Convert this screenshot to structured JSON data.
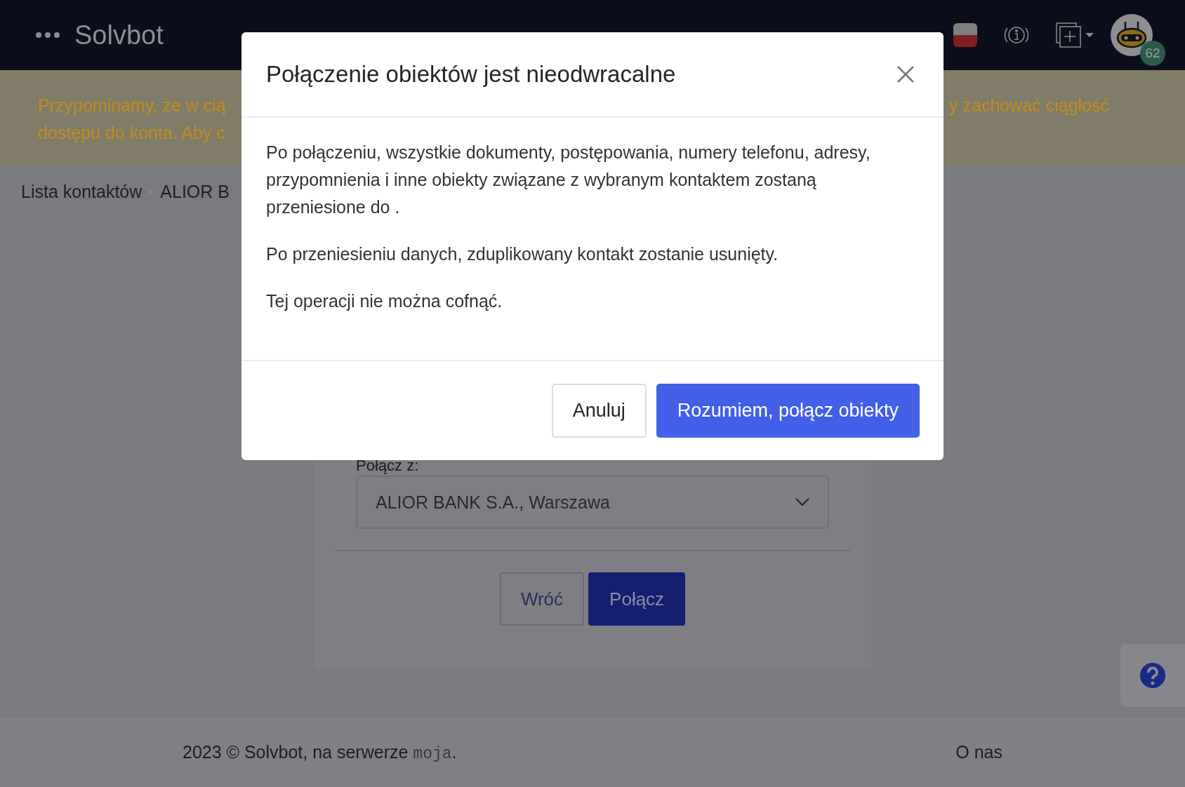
{
  "header": {
    "brand": "Solvbot",
    "notification_count": "62"
  },
  "banner": {
    "left_lines": [
      "Przypominamy, że w cią",
      "dostępu do konta. Aby c"
    ],
    "right_fragment": "y zachować ciągłość"
  },
  "breadcrumb": [
    "Lista kontaktów",
    "ALIOR B"
  ],
  "form": {
    "label": "Połącz z:",
    "select_value": "ALIOR BANK S.A., Warszawa",
    "buttons": [
      {
        "label": "Wróć",
        "kind": "secondary"
      },
      {
        "label": "Połącz",
        "kind": "primary"
      }
    ]
  },
  "footer": {
    "text": "2023 © Solvbot, na serwerze ",
    "server": "moja",
    "end": ".",
    "link": "O nas"
  },
  "modal": {
    "title": "Połączenie obiektów jest nieodwracalne",
    "paragraphs": [
      "Po połączeniu, wszystkie dokumenty, postępowania, numery telefonu, adresy, przypomnienia i inne obiekty związane z wybranym kontaktem zostaną przeniesione do .",
      "Po przeniesieniu danych, zduplikowany kontakt zostanie usunięty.",
      "Tej operacji nie można cofnąć."
    ],
    "buttons": [
      {
        "label": "Anuluj",
        "kind": "secondary"
      },
      {
        "label": "Rozumiem, połącz obiekty",
        "kind": "primary"
      }
    ]
  }
}
